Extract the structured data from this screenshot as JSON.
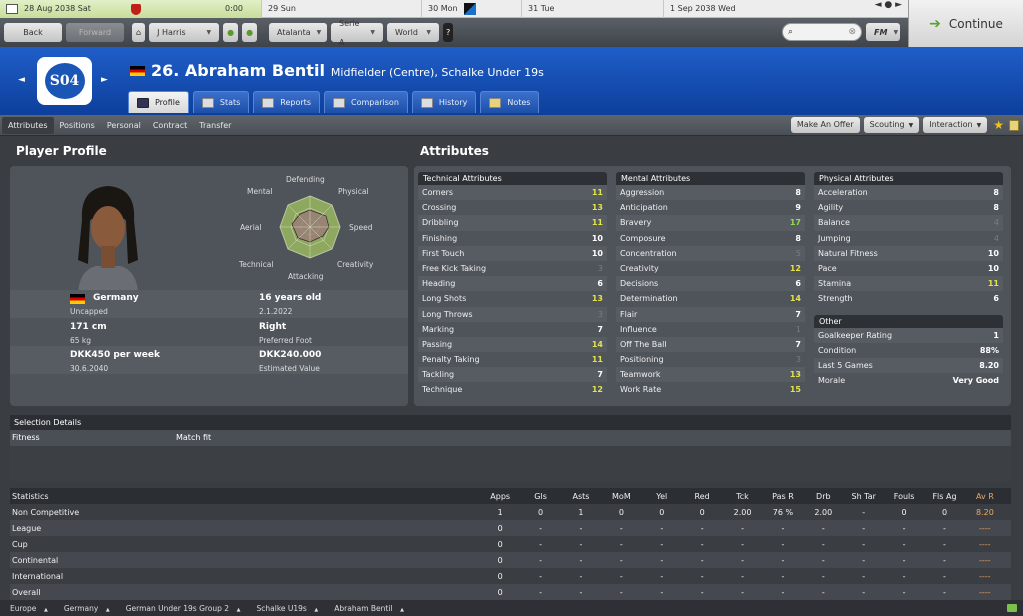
{
  "timeline": {
    "current_date": "28 Aug 2038",
    "current_day": "Sat",
    "current_time": "0:00",
    "days": [
      "29 Sun",
      "30 Mon",
      "31 Tue",
      "1 Sep 2038 Wed"
    ],
    "nav": "◄ ● ►"
  },
  "continue": {
    "label": "Continue"
  },
  "navbar": {
    "back": "Back",
    "forward": "Forward",
    "manager": "J Harris",
    "club": "Atalanta",
    "league": "Serie A",
    "world": "World",
    "fm": "FM",
    "search_placeholder": ""
  },
  "header": {
    "club_badge_text": "S04",
    "player_name": "26. Abraham Bentil",
    "player_role": "Midfielder (Centre), Schalke Under 19s",
    "tabs": [
      "Profile",
      "Stats",
      "Reports",
      "Comparison",
      "History",
      "Notes"
    ]
  },
  "subnav": {
    "tabs": [
      "Attributes",
      "Positions",
      "Personal",
      "Contract",
      "Transfer"
    ],
    "make_offer": "Make An Offer",
    "scouting": "Scouting",
    "interaction": "Interaction"
  },
  "profile": {
    "title": "Player Profile",
    "radar_labels": [
      "Defending",
      "Physical",
      "Speed",
      "Creativity",
      "Attacking",
      "Technical",
      "Aerial",
      "Mental"
    ],
    "nationality": "Germany",
    "caps": "Uncapped",
    "age": "16 years old",
    "dob": "2.1.2022",
    "height": "171 cm",
    "weight": "65 kg",
    "foot": "Right",
    "foot_label": "Preferred Foot",
    "wage": "DKK450 per week",
    "contract_end": "30.6.2040",
    "value": "DKK240.000",
    "value_label": "Estimated Value"
  },
  "attributes": {
    "title": "Attributes",
    "technical_title": "Technical Attributes",
    "technical": [
      [
        "Corners",
        "11"
      ],
      [
        "Crossing",
        "13"
      ],
      [
        "Dribbling",
        "11"
      ],
      [
        "Finishing",
        "10"
      ],
      [
        "First Touch",
        "10"
      ],
      [
        "Free Kick Taking",
        "3"
      ],
      [
        "Heading",
        "6"
      ],
      [
        "Long Shots",
        "13"
      ],
      [
        "Long Throws",
        "3"
      ],
      [
        "Marking",
        "7"
      ],
      [
        "Passing",
        "14"
      ],
      [
        "Penalty Taking",
        "11"
      ],
      [
        "Tackling",
        "7"
      ],
      [
        "Technique",
        "12"
      ]
    ],
    "mental_title": "Mental Attributes",
    "mental": [
      [
        "Aggression",
        "8"
      ],
      [
        "Anticipation",
        "9"
      ],
      [
        "Bravery",
        "17"
      ],
      [
        "Composure",
        "8"
      ],
      [
        "Concentration",
        "5"
      ],
      [
        "Creativity",
        "12"
      ],
      [
        "Decisions",
        "6"
      ],
      [
        "Determination",
        "14"
      ],
      [
        "Flair",
        "7"
      ],
      [
        "Influence",
        "1"
      ],
      [
        "Off The Ball",
        "7"
      ],
      [
        "Positioning",
        "3"
      ],
      [
        "Teamwork",
        "13"
      ],
      [
        "Work Rate",
        "15"
      ]
    ],
    "physical_title": "Physical Attributes",
    "physical": [
      [
        "Acceleration",
        "8"
      ],
      [
        "Agility",
        "8"
      ],
      [
        "Balance",
        "4"
      ],
      [
        "Jumping",
        "4"
      ],
      [
        "Natural Fitness",
        "10"
      ],
      [
        "Pace",
        "10"
      ],
      [
        "Stamina",
        "11"
      ],
      [
        "Strength",
        "6"
      ]
    ],
    "other_title": "Other",
    "other": [
      [
        "Goalkeeper Rating",
        "1"
      ],
      [
        "Condition",
        "88%"
      ],
      [
        "Last 5 Games",
        "8.20"
      ],
      [
        "Morale",
        "Very Good"
      ]
    ]
  },
  "selection": {
    "title": "Selection Details",
    "label": "Fitness",
    "value": "Match fit"
  },
  "stats": {
    "title": "Statistics",
    "columns": [
      "Apps",
      "Gls",
      "Asts",
      "MoM",
      "Yel",
      "Red",
      "Tck",
      "Pas R",
      "Drb",
      "Sh Tar",
      "Fouls",
      "Fls Ag",
      "Av R"
    ],
    "rows": [
      {
        "label": "Non Competitive",
        "values": [
          "1",
          "0",
          "1",
          "0",
          "0",
          "0",
          "2.00",
          "76 %",
          "2.00",
          "-",
          "0",
          "0",
          "8.20"
        ]
      },
      {
        "label": "League",
        "values": [
          "0",
          "-",
          "-",
          "-",
          "-",
          "-",
          "-",
          "-",
          "-",
          "-",
          "-",
          "-",
          "----"
        ]
      },
      {
        "label": "Cup",
        "values": [
          "0",
          "-",
          "-",
          "-",
          "-",
          "-",
          "-",
          "-",
          "-",
          "-",
          "-",
          "-",
          "----"
        ]
      },
      {
        "label": "Continental",
        "values": [
          "0",
          "-",
          "-",
          "-",
          "-",
          "-",
          "-",
          "-",
          "-",
          "-",
          "-",
          "-",
          "----"
        ]
      },
      {
        "label": "International",
        "values": [
          "0",
          "-",
          "-",
          "-",
          "-",
          "-",
          "-",
          "-",
          "-",
          "-",
          "-",
          "-",
          "----"
        ]
      },
      {
        "label": "Overall",
        "values": [
          "0",
          "-",
          "-",
          "-",
          "-",
          "-",
          "-",
          "-",
          "-",
          "-",
          "-",
          "-",
          "----"
        ]
      }
    ]
  },
  "breadcrumb": [
    "Europe",
    "Germany",
    "German Under 19s Group 2",
    "Schalke U19s",
    "Abraham Bentil"
  ]
}
